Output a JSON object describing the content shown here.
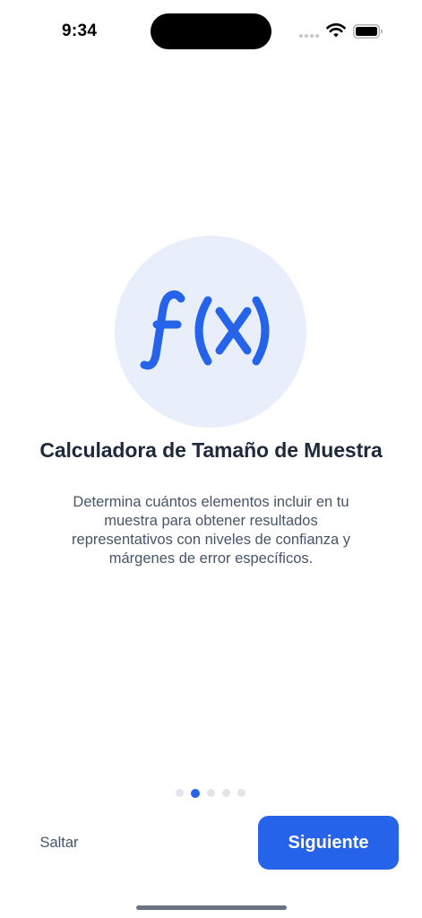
{
  "status_bar": {
    "time": "9:34",
    "icons": [
      "cellular-signal-icon",
      "wifi-icon",
      "battery-icon"
    ]
  },
  "onboarding": {
    "illustration_icon": "function-fx-icon",
    "title": "Calculadora de Tamaño de Muestra",
    "description": "Determina cuántos elementos incluir en tu muestra para obtener resultados representativos con niveles de confianza y márgenes de error específicos.",
    "pagination": {
      "total_pages": 5,
      "current_page": 2
    }
  },
  "actions": {
    "skip_label": "Saltar",
    "next_label": "Siguiente"
  },
  "colors": {
    "accent": "#2563eb",
    "illustration_background": "#e8effb",
    "title_text": "#1e293b",
    "body_text": "#475569",
    "inactive_dot": "#e2e4e8"
  }
}
